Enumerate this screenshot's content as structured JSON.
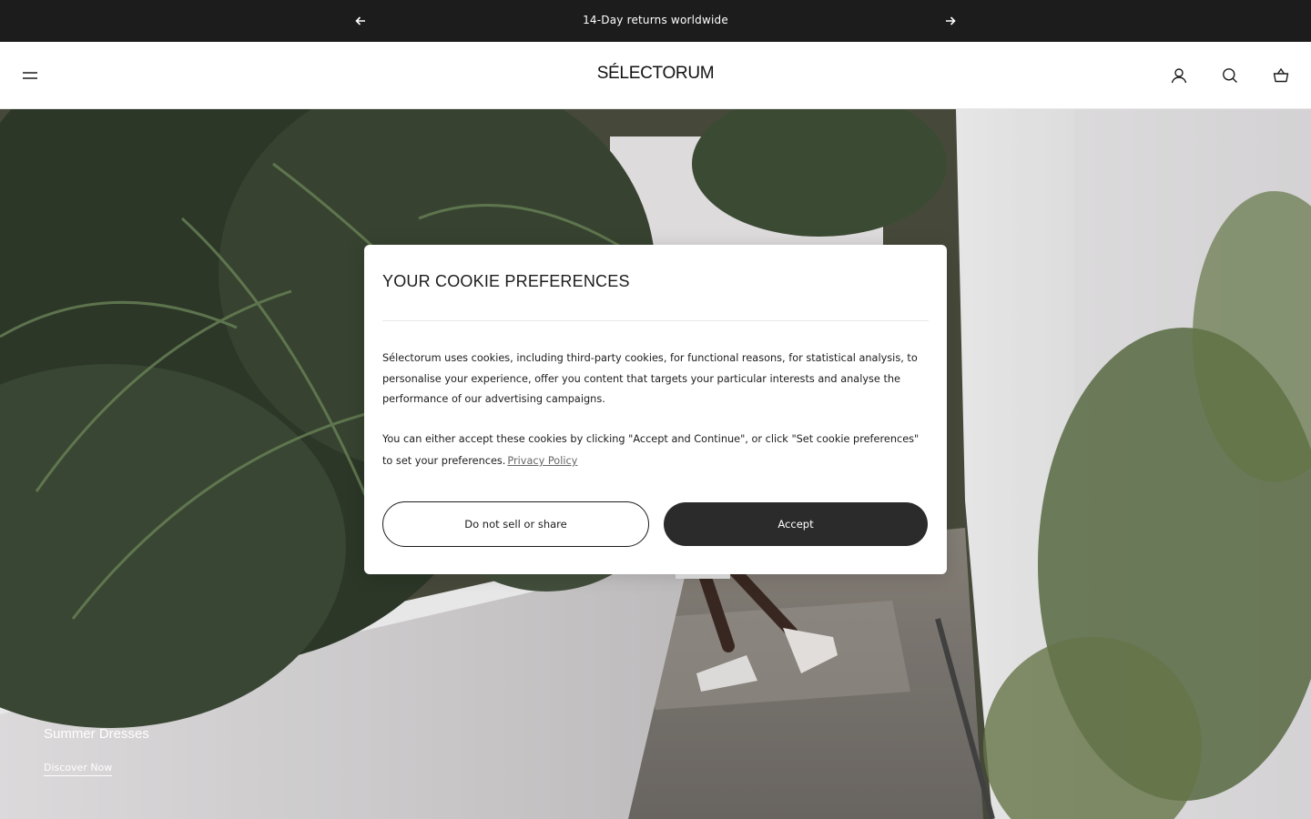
{
  "announcement": {
    "message": "14-Day returns worldwide",
    "prev_icon": "arrow-left-icon",
    "next_icon": "arrow-right-icon"
  },
  "header": {
    "logo": "SÉLECTORUM",
    "menu_icon": "hamburger-menu-icon",
    "account_icon": "user-icon",
    "search_icon": "search-icon",
    "cart_icon": "shopping-basket-icon"
  },
  "hero": {
    "title": "Summer Dresses",
    "link": "Discover Now"
  },
  "cookie_modal": {
    "title": "YOUR COOKIE PREFERENCES",
    "paragraph1": "Sélectorum uses cookies, including third-party cookies, for functional reasons, for statistical analysis, to personalise your experience, offer you content that targets your particular interests and analyse the performance of our advertising campaigns.",
    "paragraph2": "You can either accept these cookies by clicking \"Accept and Continue\", or click \"Set cookie preferences\" to set your preferences.",
    "privacy_link": "Privacy Policy",
    "secondary_button": "Do not sell or share",
    "primary_button": "Accept"
  },
  "colors": {
    "announcement_bg": "#1c1c1c",
    "primary_button_bg": "#2b2b2b",
    "text": "#1c1c1c"
  }
}
